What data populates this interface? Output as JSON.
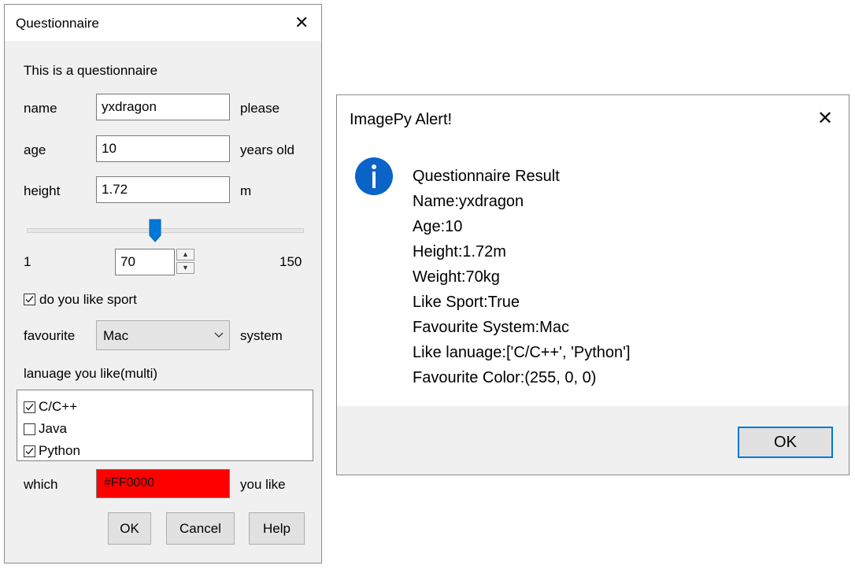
{
  "questionnaire": {
    "title": "Questionnaire",
    "intro": "This is a questionnaire",
    "name": {
      "label": "name",
      "value": "yxdragon",
      "suffix": "please"
    },
    "age": {
      "label": "age",
      "value": "10",
      "suffix": "years old"
    },
    "height": {
      "label": "height",
      "value": "1.72",
      "suffix": "m"
    },
    "weight": {
      "min": "1",
      "value": "70",
      "max": "150",
      "slider_fraction": 0.463
    },
    "sport": {
      "label": "do you like sport",
      "checked": true
    },
    "favourite": {
      "label": "favourite",
      "value": "Mac",
      "suffix": "system"
    },
    "languages": {
      "label": "lanuage you like(multi)",
      "items": [
        {
          "label": "C/C++",
          "checked": true
        },
        {
          "label": "Java",
          "checked": false
        },
        {
          "label": "Python",
          "checked": true
        }
      ]
    },
    "color": {
      "label": "which",
      "value": "#FF0000",
      "suffix": "you like"
    },
    "buttons": {
      "ok": "OK",
      "cancel": "Cancel",
      "help": "Help"
    }
  },
  "alert": {
    "title": "ImagePy Alert!",
    "icon": "info-icon",
    "lines": [
      "Questionnaire Result",
      "Name:yxdragon",
      "Age:10",
      "Height:1.72m",
      "Weight:70kg",
      "Like Sport:True",
      "Favourite System:Mac",
      "Like lanuage:['C/C++', 'Python']",
      "Favourite Color:(255, 0, 0)"
    ],
    "ok": "OK"
  },
  "colors": {
    "accent": "#0078d7",
    "swatch": "#ff0000",
    "info_icon": "#0a64c8"
  }
}
